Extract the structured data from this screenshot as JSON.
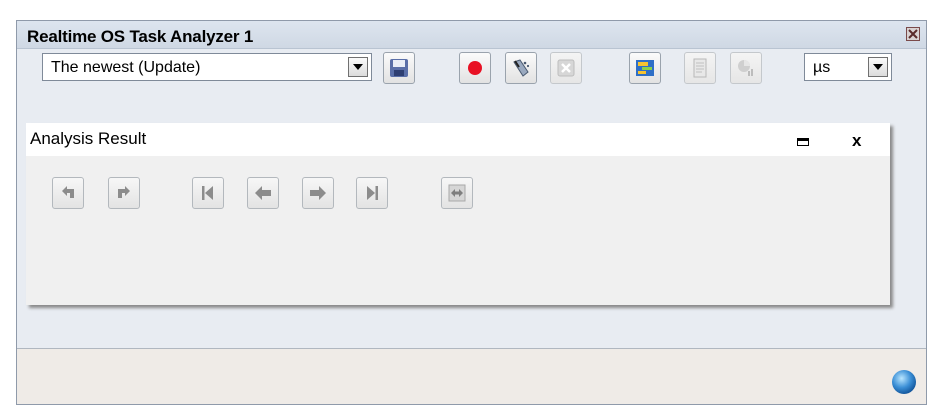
{
  "window": {
    "title": "Realtime OS Task Analyzer 1"
  },
  "toolbar": {
    "mode_select": {
      "value": "The newest (Update)"
    },
    "unit_select": {
      "value": "µs"
    }
  },
  "panel": {
    "title": "Analysis Result",
    "close_label": "x"
  },
  "colors": {
    "record_red": "#e81123",
    "title_bg": "#d6dfe9",
    "panel_bg": "#f0f0f0",
    "status_bg": "#efebe7"
  }
}
